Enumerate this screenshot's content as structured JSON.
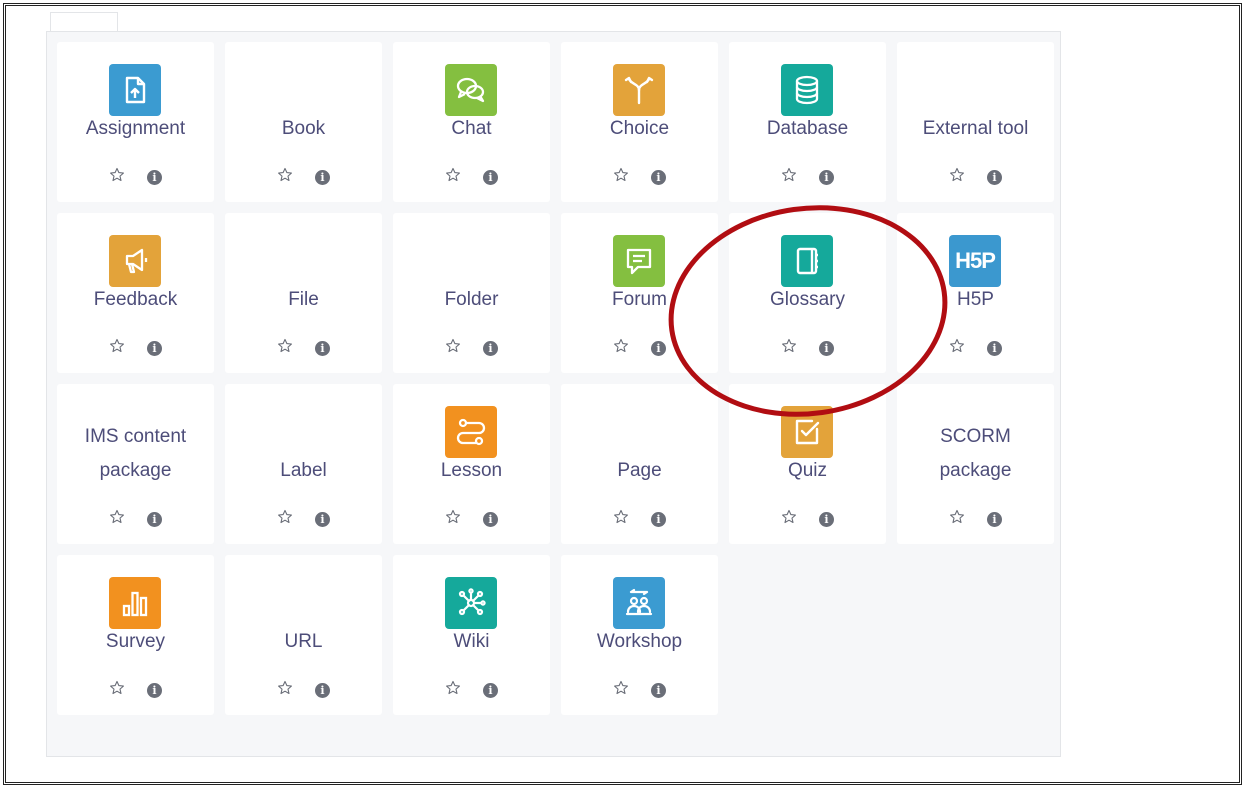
{
  "colors": {
    "label": "#4d4d79",
    "assessment": "#399be2",
    "collaboration": "#5cb85c",
    "interactive": "#f7a130",
    "admin": "#11a99d",
    "h5p": "#3b98cf",
    "annotation": "#b10d12"
  },
  "activities": [
    {
      "name": "Assignment",
      "icon": "assignment-icon",
      "color": "#3b9bd1"
    },
    {
      "name": "Book",
      "icon": "",
      "color": ""
    },
    {
      "name": "Chat",
      "icon": "chat-icon",
      "color": "#84bf40"
    },
    {
      "name": "Choice",
      "icon": "choice-icon",
      "color": "#e3a33a"
    },
    {
      "name": "Database",
      "icon": "database-icon",
      "color": "#15a99b"
    },
    {
      "name": "External tool",
      "icon": "",
      "color": ""
    },
    {
      "name": "Feedback",
      "icon": "feedback-icon",
      "color": "#e3a33a"
    },
    {
      "name": "File",
      "icon": "",
      "color": ""
    },
    {
      "name": "Folder",
      "icon": "",
      "color": ""
    },
    {
      "name": "Forum",
      "icon": "forum-icon",
      "color": "#84bf40"
    },
    {
      "name": "Glossary",
      "icon": "glossary-icon",
      "color": "#15a99b"
    },
    {
      "name": "H5P",
      "icon": "h5p-icon",
      "color": "#3b98cf"
    },
    {
      "name": "IMS content\npackage",
      "icon": "",
      "color": ""
    },
    {
      "name": "Label",
      "icon": "",
      "color": ""
    },
    {
      "name": "Lesson",
      "icon": "lesson-icon",
      "color": "#f2911f"
    },
    {
      "name": "Page",
      "icon": "",
      "color": ""
    },
    {
      "name": "Quiz",
      "icon": "quiz-icon",
      "color": "#e3a33a"
    },
    {
      "name": "SCORM\npackage",
      "icon": "",
      "color": ""
    },
    {
      "name": "Survey",
      "icon": "survey-icon",
      "color": "#f2911f"
    },
    {
      "name": "URL",
      "icon": "",
      "color": ""
    },
    {
      "name": "Wiki",
      "icon": "wiki-icon",
      "color": "#15a99b"
    },
    {
      "name": "Workshop",
      "icon": "workshop-icon",
      "color": "#3b9bd1"
    }
  ],
  "info_glyph": "i",
  "h5p_glyph": "H5P"
}
